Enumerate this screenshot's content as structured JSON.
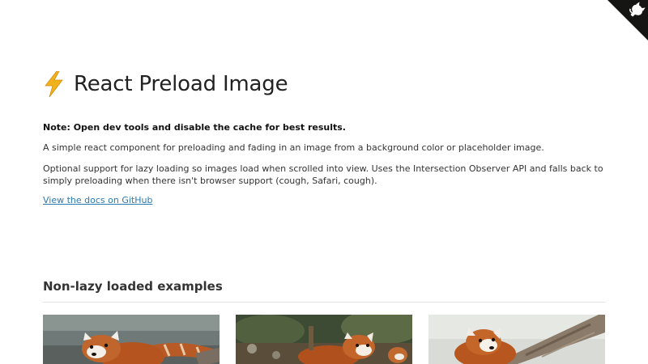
{
  "page": {
    "title": "React Preload Image",
    "title_icon": "lightning-bolt-icon",
    "note": "Note: Open dev tools and disable the cache for best results.",
    "paragraph_1": "A simple react component for preloading and fading in an image from a background color or placeholder image.",
    "paragraph_2": "Optional support for lazy loading so images load when scrolled into view. Uses the Intersection Observer API and falls back to simply preloading when there isn't browser support (cough, Safari, cough).",
    "docs_link": "View the docs on GitHub"
  },
  "corner": {
    "icon": "github-octocat-icon",
    "background": "#151513"
  },
  "section": {
    "heading": "Non-lazy loaded examples",
    "images": [
      {
        "subject": "red-panda-photo"
      },
      {
        "subject": "red-panda-photo"
      },
      {
        "subject": "red-panda-photo"
      }
    ]
  },
  "colors": {
    "link": "#2a7ab0",
    "bolt": "#f2b21c",
    "text": "#222222"
  }
}
